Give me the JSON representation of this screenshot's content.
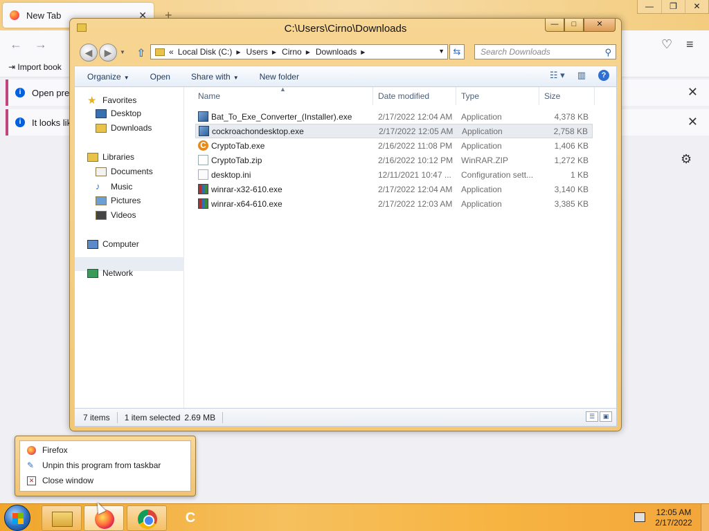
{
  "firefox": {
    "tab_title": "New Tab",
    "tab_close": "✕",
    "new_tab_plus": "+",
    "window_controls": [
      "—",
      "❐",
      "✕"
    ],
    "bookmark_import": "Import book",
    "bar1_text": "Open prev",
    "bar2_text": "It looks lik",
    "bar_close": "✕",
    "settings_icon": "gear-icon"
  },
  "explorer": {
    "title": "C:\\Users\\Cirno\\Downloads",
    "caption_buttons": [
      "—",
      "□",
      "✕"
    ],
    "address": {
      "overflow": "«",
      "crumbs": [
        "Local Disk (C:)",
        "Users",
        "Cirno",
        "Downloads"
      ]
    },
    "search_placeholder": "Search Downloads",
    "toolbar": {
      "organize": "Organize",
      "open": "Open",
      "share_with": "Share with",
      "new_folder": "New folder"
    },
    "nav": {
      "favorites": "Favorites",
      "desktop": "Desktop",
      "downloads": "Downloads",
      "libraries": "Libraries",
      "documents": "Documents",
      "music": "Music",
      "pictures": "Pictures",
      "videos": "Videos",
      "computer": "Computer",
      "network": "Network"
    },
    "columns": {
      "name": "Name",
      "date": "Date modified",
      "type": "Type",
      "size": "Size"
    },
    "files": [
      {
        "name": "Bat_To_Exe_Converter_(Installer).exe",
        "date": "2/17/2022 12:04 AM",
        "type": "Application",
        "size": "4,378 KB",
        "icon": "app"
      },
      {
        "name": "cockroachondesktop.exe",
        "date": "2/17/2022 12:05 AM",
        "type": "Application",
        "size": "2,758 KB",
        "icon": "app"
      },
      {
        "name": "CryptoTab.exe",
        "date": "2/16/2022 11:08 PM",
        "type": "Application",
        "size": "1,406 KB",
        "icon": "cryptotab"
      },
      {
        "name": "CryptoTab.zip",
        "date": "2/16/2022 10:12 PM",
        "type": "WinRAR.ZIP",
        "size": "1,272 KB",
        "icon": "zip"
      },
      {
        "name": "desktop.ini",
        "date": "12/11/2021 10:47 ...",
        "type": "Configuration sett...",
        "size": "1 KB",
        "icon": "ini"
      },
      {
        "name": "winrar-x32-610.exe",
        "date": "2/17/2022 12:04 AM",
        "type": "Application",
        "size": "3,140 KB",
        "icon": "rar"
      },
      {
        "name": "winrar-x64-610.exe",
        "date": "2/17/2022 12:03 AM",
        "type": "Application",
        "size": "3,385 KB",
        "icon": "rar"
      }
    ],
    "status": {
      "count": "7 items",
      "selection": "1 item selected",
      "size": "2.69 MB"
    }
  },
  "jumplist": {
    "items": [
      "Firefox",
      "Unpin this program from taskbar",
      "Close window"
    ]
  },
  "taskbar": {
    "clock_time": "12:05 AM",
    "clock_date": "2/17/2022"
  }
}
